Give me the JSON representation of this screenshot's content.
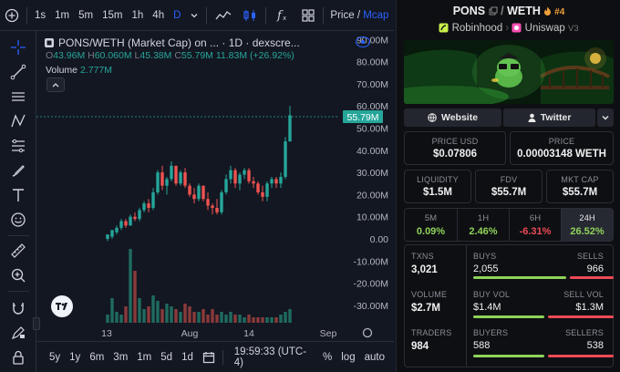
{
  "toolbar": {
    "timeframes": [
      "1s",
      "1m",
      "5m",
      "15m",
      "1h",
      "4h",
      "D"
    ],
    "active_timeframe": "D",
    "fx_label": "f",
    "price_label": "Price",
    "separator": "/",
    "mcap_label": "Mcap"
  },
  "chart": {
    "legend_title": "PONS/WETH (Market Cap) on ... · 1D · dexscre...",
    "ohlc": {
      "o_label": "O",
      "o": "43.96M",
      "h_label": "H",
      "h": "60.060M",
      "l_label": "L",
      "l": "45.38M",
      "c_label": "C",
      "c": "55.79M",
      "change": "11.83M (+26.92%)"
    },
    "volume_label": "Volume",
    "volume_value": "2.777M",
    "y_axis": [
      "90.00M",
      "80.00M",
      "70.00M",
      "60.00M",
      "50.00M",
      "40.00M",
      "30.00M",
      "20.00M",
      "10.00M",
      "0.00",
      "-10.00M",
      "-20.00M",
      "-30.00M"
    ],
    "current_price_label": "55.79M",
    "x_axis": [
      "13",
      "Aug",
      "14",
      "Sep"
    ],
    "colors": {
      "up": "#26a69a",
      "down": "#ef5350",
      "accent": "#2962ff"
    }
  },
  "bottombar": {
    "ranges": [
      "5y",
      "1y",
      "6m",
      "3m",
      "1m",
      "5d",
      "1d"
    ],
    "time": "19:59:33 (UTC-4)",
    "percent": "%",
    "log": "log",
    "auto": "auto"
  },
  "chart_data": {
    "type": "candlestick",
    "y_unit": "market cap (USD)",
    "ylim": [
      -40000000,
      95000000
    ],
    "last": {
      "open": 43960000,
      "high": 60060000,
      "low": 45380000,
      "close": 55790000
    },
    "candles": [
      [
        0,
        1,
        -1,
        2
      ],
      [
        1,
        3,
        0,
        4
      ],
      [
        3,
        6,
        2,
        5
      ],
      [
        5,
        9,
        4,
        8
      ],
      [
        8,
        9,
        5,
        6
      ],
      [
        6,
        11,
        6,
        10
      ],
      [
        10,
        12,
        8,
        9
      ],
      [
        9,
        14,
        8,
        13
      ],
      [
        13,
        17,
        12,
        16
      ],
      [
        16,
        18,
        12,
        14
      ],
      [
        14,
        23,
        13,
        21
      ],
      [
        21,
        31,
        20,
        30
      ],
      [
        30,
        33,
        22,
        24
      ],
      [
        24,
        28,
        20,
        27
      ],
      [
        27,
        35,
        26,
        33
      ],
      [
        33,
        33,
        24,
        25
      ],
      [
        25,
        31,
        24,
        30
      ],
      [
        30,
        32,
        23,
        24
      ],
      [
        24,
        25,
        19,
        20
      ],
      [
        20,
        23,
        16,
        18
      ],
      [
        18,
        25,
        17,
        24
      ],
      [
        24,
        24,
        17,
        18
      ],
      [
        18,
        21,
        13,
        15
      ],
      [
        15,
        16,
        11,
        14
      ],
      [
        14,
        18,
        11,
        12
      ],
      [
        12,
        22,
        11,
        21
      ],
      [
        21,
        29,
        20,
        27
      ],
      [
        27,
        33,
        25,
        31
      ],
      [
        31,
        32,
        23,
        25
      ],
      [
        25,
        30,
        22,
        29
      ],
      [
        29,
        32,
        27,
        31
      ],
      [
        31,
        32,
        25,
        26
      ],
      [
        26,
        28,
        23,
        25
      ],
      [
        25,
        26,
        20,
        21
      ],
      [
        21,
        24,
        17,
        19
      ],
      [
        19,
        26,
        17,
        25
      ],
      [
        25,
        28,
        23,
        27
      ],
      [
        27,
        28,
        23,
        25
      ],
      [
        25,
        30,
        23,
        28
      ],
      [
        28,
        46,
        27,
        44
      ],
      [
        43.96,
        60.06,
        45.38,
        55.79
      ]
    ],
    "volume": [
      3,
      9,
      4,
      3,
      6,
      27,
      19,
      9,
      5,
      6,
      10,
      8,
      5,
      7,
      6,
      5,
      4,
      7,
      6,
      4,
      4,
      5,
      3,
      5,
      3,
      4,
      3,
      4,
      3,
      3,
      2,
      3,
      2,
      2,
      2,
      2,
      2,
      2,
      3,
      4,
      5
    ]
  },
  "panel": {
    "pair": "PONS",
    "quote": "WETH",
    "rank": "#4",
    "chain": "Robinhood",
    "dex": "Uniswap",
    "version": "V3",
    "website_label": "Website",
    "twitter_label": "Twitter",
    "price_usd_label": "PRICE USD",
    "price_usd": "$0.07806",
    "price_label": "PRICE",
    "price_weth": "0.00003148 WETH",
    "liquidity_label": "LIQUIDITY",
    "liquidity": "$1.5M",
    "fdv_label": "FDV",
    "fdv": "$55.7M",
    "mktcap_label": "MKT CAP",
    "mktcap": "$55.7M",
    "timeframes": [
      {
        "label": "5M",
        "value": "0.09%",
        "sign": "pos"
      },
      {
        "label": "1H",
        "value": "2.46%",
        "sign": "pos"
      },
      {
        "label": "6H",
        "value": "-6.31%",
        "sign": "neg"
      },
      {
        "label": "24H",
        "value": "26.52%",
        "sign": "pos"
      }
    ],
    "txns_label": "TXNS",
    "txns": "3,021",
    "buys_label": "BUYS",
    "buys": "2,055",
    "sells_label": "SELLS",
    "sells": "966",
    "buy_ratio": 0.68,
    "volume_label": "VOLUME",
    "volume": "$2.7M",
    "buyvol_label": "BUY VOL",
    "buyvol": "$1.4M",
    "sellvol_label": "SELL VOL",
    "sellvol": "$1.3M",
    "buyvol_ratio": 0.52,
    "traders_label": "TRADERS",
    "traders": "984",
    "buyers_label": "BUYERS",
    "buyers": "588",
    "sellers_label": "SELLERS",
    "sellers": "538",
    "buyers_ratio": 0.52,
    "colors": {
      "buy": "#8fd35a",
      "sell": "#ef4a56"
    }
  }
}
